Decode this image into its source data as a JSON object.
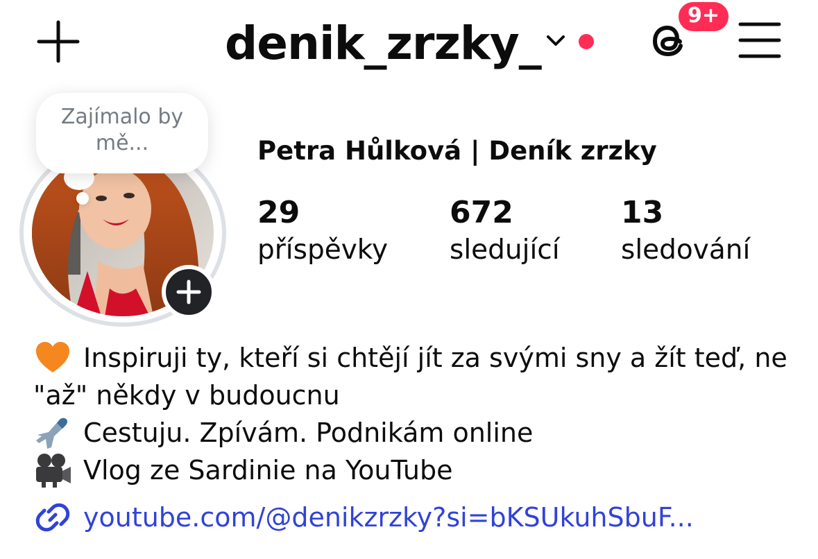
{
  "header": {
    "username": "denik_zrzky_",
    "notification_badge": "9+",
    "icons": {
      "create": "plus-icon",
      "account_switcher": "chevron-down-icon",
      "threads": "threads-icon",
      "menu": "menu-icon"
    }
  },
  "note": {
    "text": "Zajímalo by mě..."
  },
  "profile": {
    "display_name": "Petra Hůlková | Deník zrzky",
    "stats": [
      {
        "value": "29",
        "label": "příspěvky"
      },
      {
        "value": "672",
        "label": "sledující"
      },
      {
        "value": "13",
        "label": "sledování"
      }
    ]
  },
  "bio": {
    "lines": [
      {
        "emoji": "orange-heart",
        "text": "Inspiruji ty, kteří si chtějí jít za svými sny a žít teď, ne"
      },
      {
        "emoji": "",
        "text": "\"až\" někdy v budoucnu"
      },
      {
        "emoji": "airplane",
        "text": "Cestuju. Zpívám. Podnikám online"
      },
      {
        "emoji": "movie-camera",
        "text": "Vlog ze Sardinie na YouTube"
      }
    ],
    "link": "youtube.com/@denikzrzky?si=bKSUkuhSbuF..."
  },
  "colors": {
    "accent_red": "#ff2d55",
    "link_blue": "#3142d8",
    "ring_grey": "#dde1e6",
    "note_grey": "#737b84"
  }
}
